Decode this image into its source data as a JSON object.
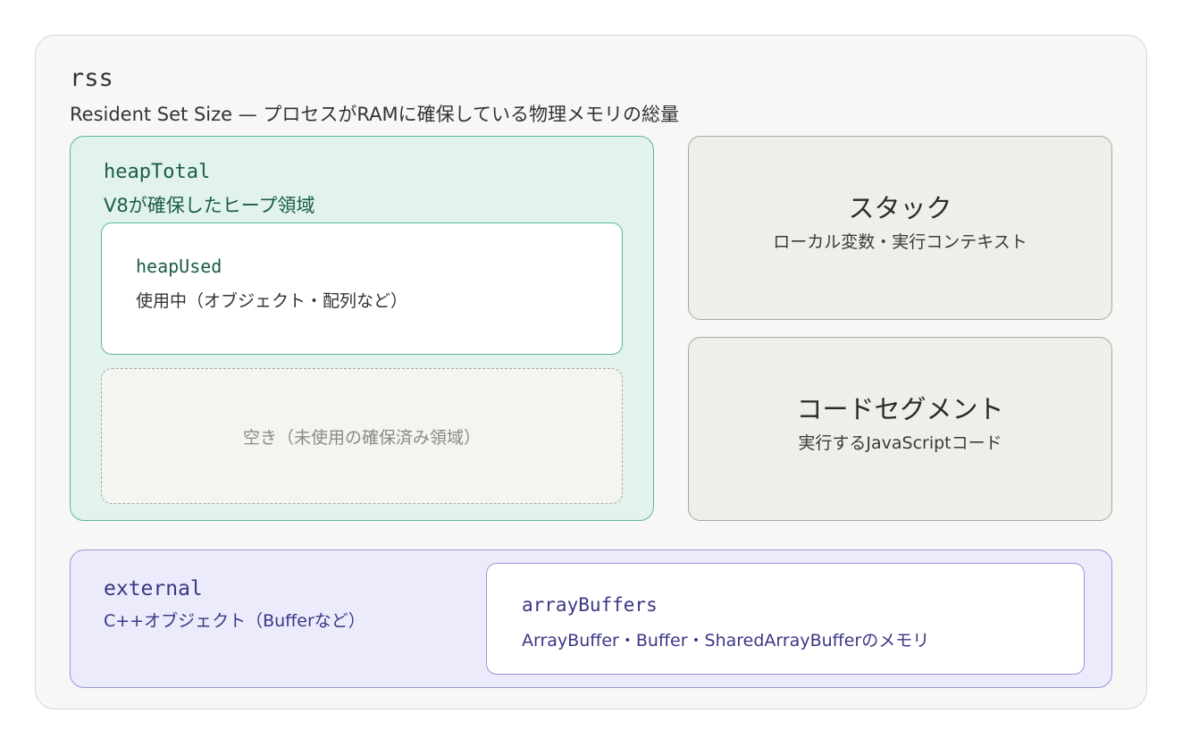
{
  "rss": {
    "title": "rss",
    "description": "Resident Set Size — プロセスがRAMに確保している物理メモリの総量"
  },
  "heap_total": {
    "title": "heapTotal",
    "description": "V8が確保したヒープ領域",
    "heap_used": {
      "title": "heapUsed",
      "description": "使用中（オブジェクト・配列など）"
    },
    "free": {
      "label": "空き（未使用の確保済み領域）"
    }
  },
  "stack": {
    "title": "スタック",
    "description": "ローカル変数・実行コンテキスト"
  },
  "code_segment": {
    "title": "コードセグメント",
    "description": "実行するJavaScriptコード"
  },
  "external": {
    "title": "external",
    "description": "C++オブジェクト（Bufferなど）",
    "array_buffers": {
      "title": "arrayBuffers",
      "description": "ArrayBuffer・Buffer・SharedArrayBufferのメモリ"
    }
  },
  "colors": {
    "heap_green": "#1b5e44",
    "external_purple": "#3b3784",
    "panel_gray": "#efeeea"
  }
}
